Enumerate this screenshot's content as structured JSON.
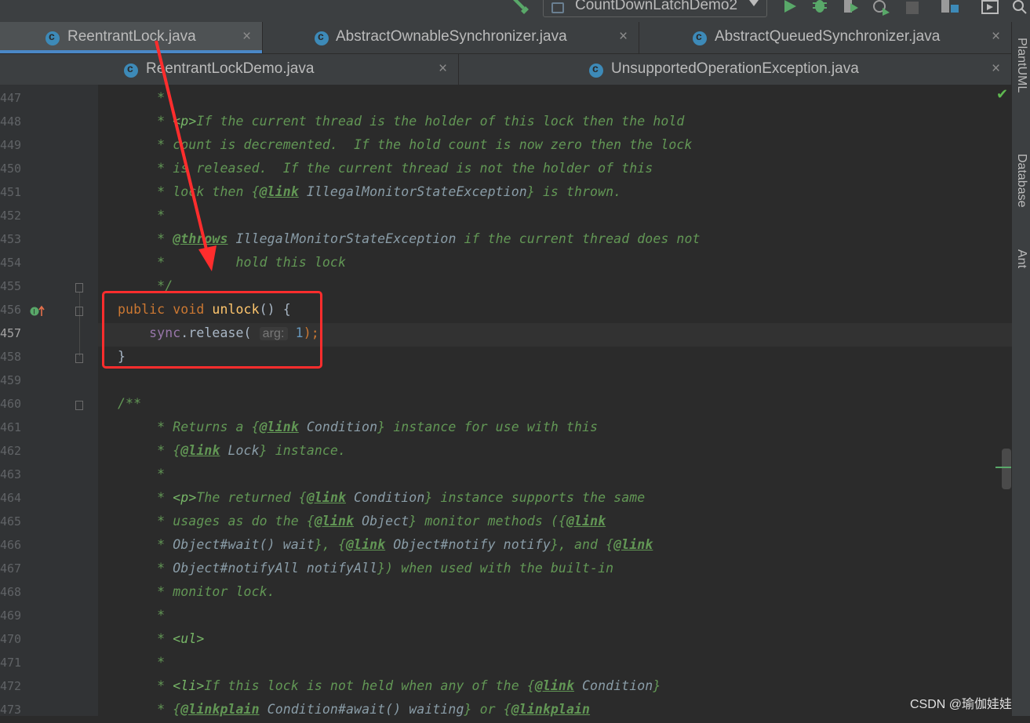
{
  "toolbar": {
    "run_config": "CountDownLatchDemo2"
  },
  "tabs_row1": [
    {
      "label": "ReentrantLock.java",
      "close": "×"
    },
    {
      "label": "AbstractOwnableSynchronizer.java",
      "close": "×"
    },
    {
      "label": "AbstractQueuedSynchronizer.java",
      "close": "×"
    }
  ],
  "tabs_row2": [
    {
      "label": "ReentrantLockDemo.java",
      "close": "×"
    },
    {
      "label": "UnsupportedOperationException.java",
      "close": "×"
    }
  ],
  "side_panels": [
    "PlantUML",
    "Database",
    "Ant"
  ],
  "line_numbers": [
    "447",
    "448",
    "449",
    "450",
    "451",
    "452",
    "453",
    "454",
    "455",
    "456",
    "457",
    "458",
    "459",
    "460",
    "461",
    "462",
    "463",
    "464",
    "465",
    "466",
    "467",
    "468",
    "469",
    "470",
    "471",
    "472",
    "473"
  ],
  "code": {
    "l447": "     *",
    "l448a": "     * ",
    "l448b": "<p>",
    "l448c": "If the current thread is the holder of this lock then the hold",
    "l449": "     * count is decremented.  If the hold count is now zero then the lock",
    "l450": "     * is released.  If the current thread is not the holder of this",
    "l451a": "     * lock then {",
    "l451b": "@link",
    "l451c": " IllegalMonitorStateException",
    "l451d": "} is thrown.",
    "l452": "     *",
    "l453a": "     * ",
    "l453b": "@throws",
    "l453c": " IllegalMonitorStateException",
    "l453d": " if the current thread does not",
    "l454": "     *         hold this lock",
    "l455": "     */",
    "l456a": "public ",
    "l456b": "void ",
    "l456c": "unlock",
    "l456d": "() {",
    "l457a": "    ",
    "l457b": "sync",
    "l457c": ".release( ",
    "l457hint": "arg:",
    "l457d": " ",
    "l457num": "1",
    "l457e": ");",
    "l458": "}",
    "l460": "/**",
    "l461a": "     * Returns a {",
    "l461b": "@link",
    "l461c": " Condition",
    "l461d": "} instance for use with this",
    "l462a": "     * {",
    "l462b": "@link",
    "l462c": " Lock",
    "l462d": "} instance.",
    "l463": "     *",
    "l464a": "     * ",
    "l464b": "<p>",
    "l464c": "The returned {",
    "l464d": "@link",
    "l464e": " Condition",
    "l464f": "} instance supports the same",
    "l465a": "     * usages as do the {",
    "l465b": "@link",
    "l465c": " Object",
    "l465d": "} monitor methods ({",
    "l465e": "@link",
    "l466a": "     * ",
    "l466b": "Object#wait() wait",
    "l466c": "}, {",
    "l466d": "@link",
    "l466e": " Object#notify notify",
    "l466f": "}, and {",
    "l466g": "@link",
    "l467a": "     * ",
    "l467b": "Object#notifyAll notifyAll",
    "l467c": "}) when used with the built-in",
    "l468": "     * monitor lock.",
    "l469": "     *",
    "l470a": "     * ",
    "l470b": "<ul>",
    "l471": "     *",
    "l472a": "     * ",
    "l472b": "<li>",
    "l472c": "If this lock is not held when any of the {",
    "l472d": "@link",
    "l472e": " Condition",
    "l472f": "}",
    "l473a": "     * {",
    "l473b": "@linkplain",
    "l473c": " Condition#await() waiting",
    "l473d": "} or {",
    "l473e": "@linkplain"
  },
  "watermark": "CSDN @瑜伽娃娃",
  "colors": {
    "annotation": "#ff2d2d",
    "comment": "#629755",
    "keyword": "#cc7832",
    "method": "#ffc66d"
  }
}
